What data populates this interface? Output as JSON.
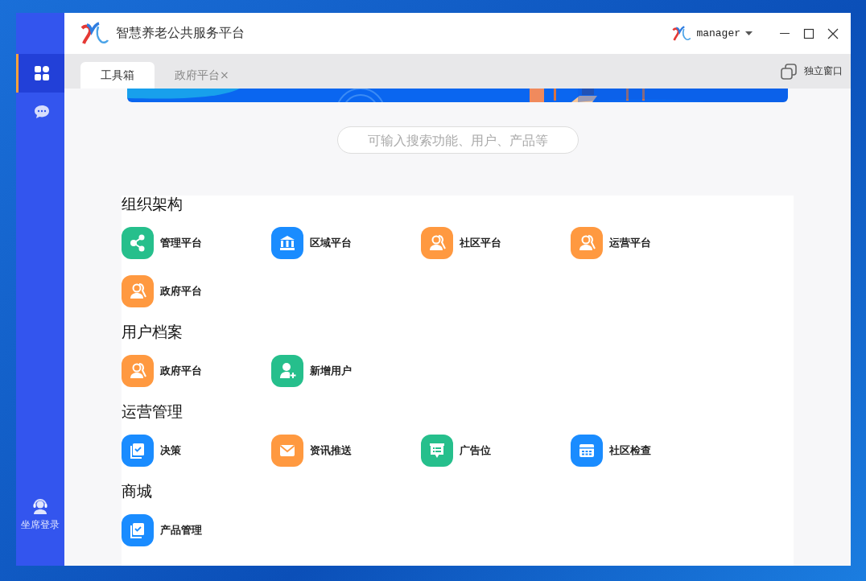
{
  "window": {
    "title": "智慧养老公共服务平台"
  },
  "user": {
    "name": "manager"
  },
  "sidebar": {
    "items": [
      {
        "kind": "apps",
        "selected": true
      },
      {
        "kind": "chat",
        "selected": false
      }
    ],
    "footer": {
      "label": "坐席登录"
    }
  },
  "tabs": [
    {
      "label": "工具箱",
      "selected": true
    },
    {
      "label": "政府平台",
      "selected": false,
      "close": "×"
    }
  ],
  "detach": {
    "label": "独立窗口"
  },
  "search": {
    "placeholder": "可输入搜索功能、用户、产品等"
  },
  "sections": [
    {
      "title": "组织架构",
      "items": [
        {
          "label": "管理平台",
          "kind": "share",
          "color": "#26bf8c"
        },
        {
          "label": "区域平台",
          "kind": "bank",
          "color": "#1a8cff"
        },
        {
          "label": "社区平台",
          "kind": "users",
          "color": "#ff9940"
        },
        {
          "label": "运营平台",
          "kind": "users",
          "color": "#ff9940"
        },
        {
          "label": "政府平台",
          "kind": "users",
          "color": "#ff9940"
        }
      ]
    },
    {
      "title": "用户档案",
      "items": [
        {
          "label": "政府平台",
          "kind": "users",
          "color": "#ff9940"
        },
        {
          "label": "新增用户",
          "kind": "useradd",
          "color": "#26bf8c"
        }
      ]
    },
    {
      "title": "运营管理",
      "items": [
        {
          "label": "决策",
          "kind": "doc",
          "color": "#1a8cff"
        },
        {
          "label": "资讯推送",
          "kind": "mail",
          "color": "#ff9940"
        },
        {
          "label": "广告位",
          "kind": "board",
          "color": "#26bf8c"
        },
        {
          "label": "社区检查",
          "kind": "calendar",
          "color": "#1a8cff"
        }
      ]
    },
    {
      "title": "商城",
      "items": [
        {
          "label": "产品管理",
          "kind": "doc",
          "color": "#1a8cff"
        }
      ]
    }
  ]
}
